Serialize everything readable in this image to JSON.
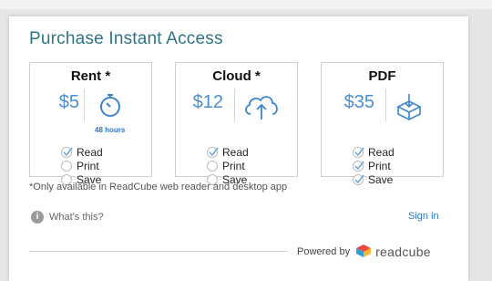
{
  "title": "Purchase Instant Access",
  "options": [
    {
      "name": "Rent *",
      "price": "$5",
      "icon": "stopwatch-icon",
      "icon_caption": "48 hours",
      "features": [
        {
          "label": "Read",
          "checked": true
        },
        {
          "label": "Print",
          "checked": false
        },
        {
          "label": "Save",
          "checked": false
        }
      ]
    },
    {
      "name": "Cloud *",
      "price": "$12",
      "icon": "cloud-upload-icon",
      "features": [
        {
          "label": "Read",
          "checked": true
        },
        {
          "label": "Print",
          "checked": false
        },
        {
          "label": "Save",
          "checked": false
        }
      ]
    },
    {
      "name": "PDF",
      "price": "$35",
      "icon": "download-box-icon",
      "features": [
        {
          "label": "Read",
          "checked": true
        },
        {
          "label": "Print",
          "checked": true
        },
        {
          "label": "Save",
          "checked": true
        }
      ]
    }
  ],
  "note": "*Only available in ReadCube web reader and desktop app",
  "whats_this": "What's this?",
  "sign_in": "Sign in",
  "powered_by": "Powered by",
  "brand": "readcube",
  "colors": {
    "title": "#2f7485",
    "price": "#4a8fd1",
    "link": "#2f78c8",
    "check": "#6aa3d8"
  }
}
